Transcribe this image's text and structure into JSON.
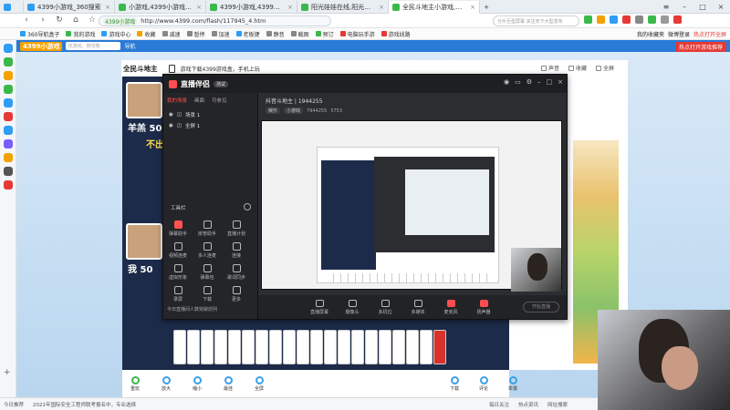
{
  "browser": {
    "tabs": [
      {
        "label": "4399小游戏_360搜索",
        "active": false,
        "color": "#2e9df5"
      },
      {
        "label": "小游戏,4399小游戏,小游戏大全",
        "active": false,
        "color": "#3ab94a"
      },
      {
        "label": "4399小游戏,4399小游戏大全,",
        "active": false,
        "color": "#3ab94a"
      },
      {
        "label": "阳光娃娃在线,阳光娃娃在线小",
        "active": false,
        "color": "#3ab94a"
      },
      {
        "label": "全民斗地主小游戏,在线玩,4",
        "active": true,
        "color": "#3ab94a"
      }
    ],
    "new_tab": "+",
    "url_badge": "4399小游戏",
    "url": "http://www.4399.com/flash/117945_4.htm",
    "search_placeholder": "分片巨型屏幕 关注天下大型发布",
    "brand_accent": "#2a7ad8"
  },
  "bookmarks": [
    "360导航盒子",
    "我的游戏",
    "游戏中心",
    "收藏",
    "减速",
    "暂停",
    "加速",
    "老板键",
    "静音",
    "截图",
    "预订",
    "电脑玩手游",
    "游戏线路"
  ],
  "bookmarks_right": [
    "我的收藏夹",
    "微博登录",
    "热点打开全屏"
  ],
  "site": {
    "logo": "4399小游戏",
    "search_placeholder": "找游戏、搜攻略",
    "nav": "导航",
    "hot": "热点打开游戏推荐",
    "game_title": "全民斗地主",
    "notice": "游戏下载4399游戏盒，手机上玩",
    "header_options": [
      "声音",
      "收藏",
      "全屏"
    ]
  },
  "game": {
    "player1_name": "羊羔 500",
    "player2_name": "我 50",
    "status_text": "不出"
  },
  "live_window": {
    "logo": "直播伴侣",
    "tag": "测试",
    "tabs": [
      "我的场景",
      "画面",
      "可参见"
    ],
    "scenes": [
      "场景 1",
      "全屏 1"
    ],
    "tool_title": "工具栏",
    "tools": [
      "弹幕助手",
      "房管助手",
      "直播计划",
      "视频连麦",
      "多人连麦",
      "连接",
      "虚拟形象",
      "弹幕包",
      "歌词同步",
      "录屏",
      "下载",
      "更多"
    ],
    "room_info": "抖音斗地主 | 1944255",
    "room_id": "7944255",
    "followers": "5753",
    "sub_tags": [
      "娱乐",
      "小游戏"
    ],
    "bottom_buttons": [
      "直播屏幕",
      "摄像头",
      "多机位",
      "多媒体",
      "麦克风",
      "扬声器"
    ],
    "start": "开始直播",
    "footer": "今日直播间人数突破前列"
  },
  "controls": [
    "重玩",
    "放大",
    "缩小",
    "最佳",
    "全屏"
  ],
  "controls_right": [
    "下载",
    "评论",
    "举报"
  ],
  "statusbar": [
    "今日推荐",
    "2021年国际安全工程师联考报名中，专业选择",
    "每日关注",
    "热点资讯",
    "网址搜索"
  ]
}
